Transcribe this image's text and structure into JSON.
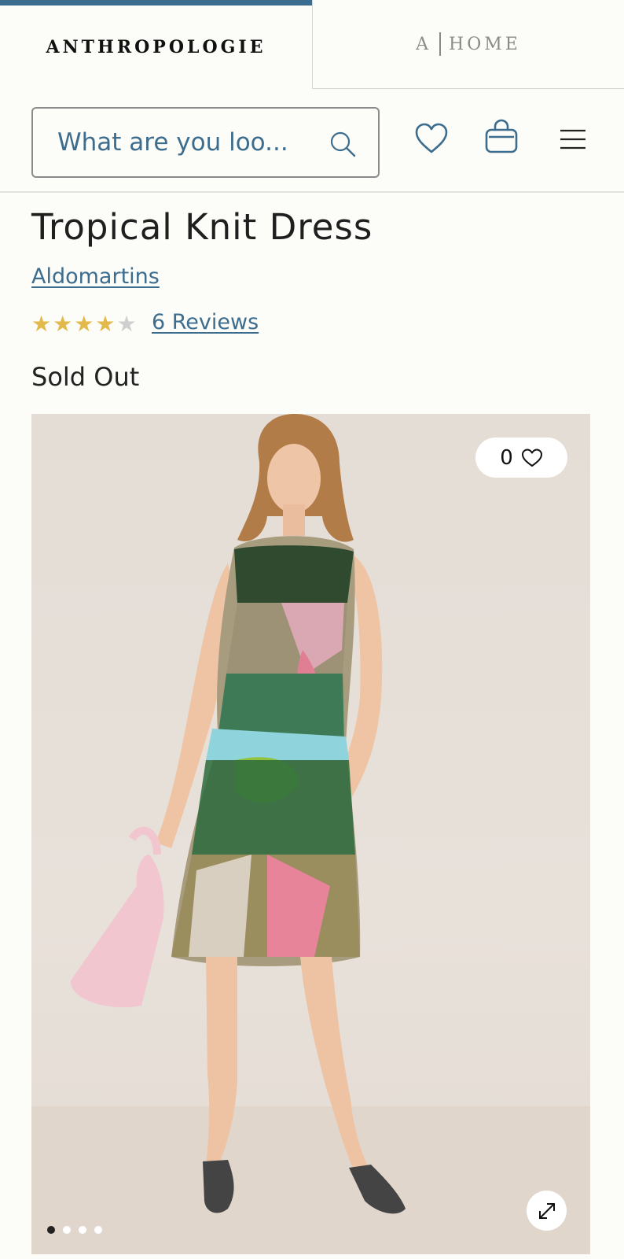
{
  "brand_tabs": {
    "main_logo": "ANTHROPOLOGIE",
    "home_logo_letter": "A",
    "home_logo_text": "HOME"
  },
  "header": {
    "search_placeholder": "What are you loo..."
  },
  "product": {
    "title": "Tropical Knit Dress",
    "brand": "Aldomartins",
    "rating": 4,
    "rating_max": 5,
    "reviews_label": "6 Reviews",
    "status": "Sold Out"
  },
  "gallery": {
    "favorites_count": "0",
    "image_count": 4,
    "active_image": 1
  },
  "colors": {
    "accent": "#3d6d8e",
    "star": "#e2b94b"
  }
}
